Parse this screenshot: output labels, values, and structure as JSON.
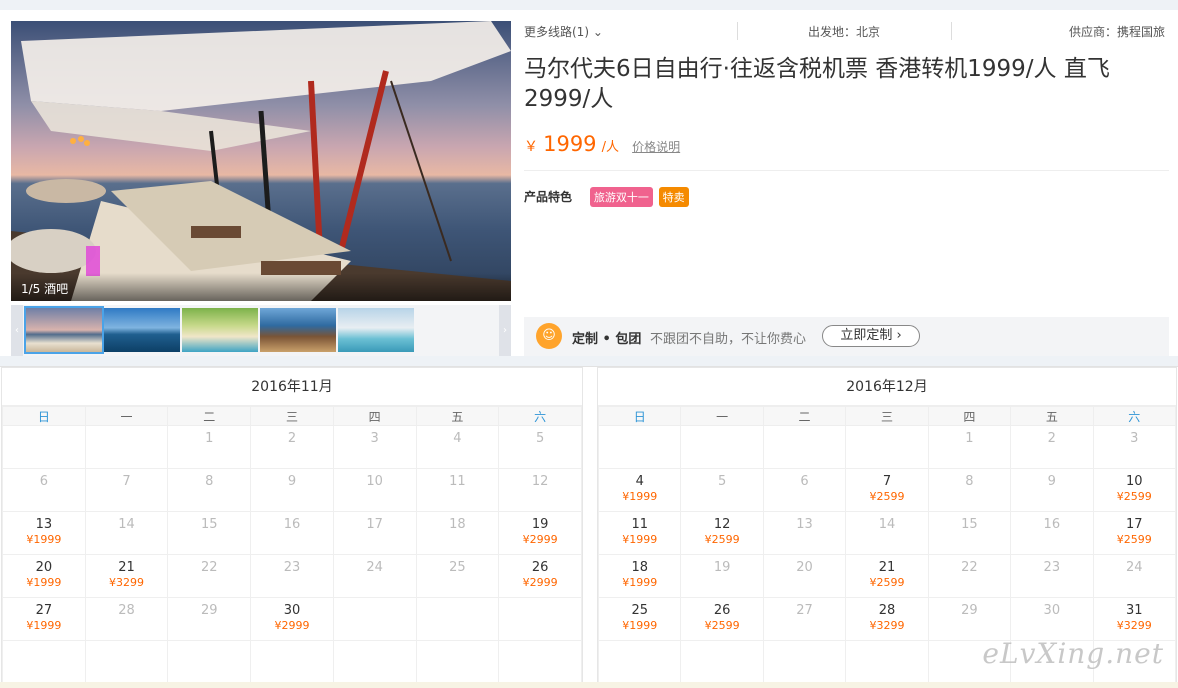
{
  "gallery": {
    "caption": "1/5 酒吧",
    "thumbs": [
      "thumb-1",
      "thumb-2",
      "thumb-3",
      "thumb-4",
      "thumb-5"
    ]
  },
  "info": {
    "more_routes": "更多线路(1)",
    "departure": "出发地：北京",
    "supplier": "供应商：携程国旅",
    "title": "马尔代夫6日自由行·往返含税机票 香港转机1999/人 直飞2999/人",
    "price_symbol": "￥",
    "price": "1999",
    "price_unit": "/人",
    "price_note": "价格说明",
    "feature_label": "产品特色",
    "tags": [
      "旅游双十一",
      "特卖"
    ]
  },
  "custom": {
    "name": "定制 • 包团",
    "desc": "不跟团不自助，不让你费心",
    "button": "立即定制 ›"
  },
  "calendar_nov": {
    "title": "2016年11月",
    "weekdays": [
      "日",
      "一",
      "二",
      "三",
      "四",
      "五",
      "六"
    ],
    "rows": [
      [
        {
          "d": ""
        },
        {
          "d": ""
        },
        {
          "d": "1"
        },
        {
          "d": "2"
        },
        {
          "d": "3"
        },
        {
          "d": "4"
        },
        {
          "d": "5"
        }
      ],
      [
        {
          "d": "6"
        },
        {
          "d": "7"
        },
        {
          "d": "8"
        },
        {
          "d": "9"
        },
        {
          "d": "10"
        },
        {
          "d": "11"
        },
        {
          "d": "12"
        }
      ],
      [
        {
          "d": "13",
          "p": "¥1999"
        },
        {
          "d": "14"
        },
        {
          "d": "15"
        },
        {
          "d": "16"
        },
        {
          "d": "17"
        },
        {
          "d": "18"
        },
        {
          "d": "19",
          "p": "¥2999"
        }
      ],
      [
        {
          "d": "20",
          "p": "¥1999"
        },
        {
          "d": "21",
          "p": "¥3299"
        },
        {
          "d": "22"
        },
        {
          "d": "23"
        },
        {
          "d": "24"
        },
        {
          "d": "25"
        },
        {
          "d": "26",
          "p": "¥2999"
        }
      ],
      [
        {
          "d": "27",
          "p": "¥1999"
        },
        {
          "d": "28"
        },
        {
          "d": "29"
        },
        {
          "d": "30",
          "p": "¥2999"
        },
        {
          "d": ""
        },
        {
          "d": ""
        },
        {
          "d": ""
        }
      ],
      [
        {
          "d": ""
        },
        {
          "d": ""
        },
        {
          "d": ""
        },
        {
          "d": ""
        },
        {
          "d": ""
        },
        {
          "d": ""
        },
        {
          "d": ""
        }
      ]
    ]
  },
  "calendar_dec": {
    "title": "2016年12月",
    "weekdays": [
      "日",
      "一",
      "二",
      "三",
      "四",
      "五",
      "六"
    ],
    "rows": [
      [
        {
          "d": ""
        },
        {
          "d": ""
        },
        {
          "d": ""
        },
        {
          "d": ""
        },
        {
          "d": "1"
        },
        {
          "d": "2"
        },
        {
          "d": "3"
        }
      ],
      [
        {
          "d": "4",
          "p": "¥1999"
        },
        {
          "d": "5"
        },
        {
          "d": "6"
        },
        {
          "d": "7",
          "p": "¥2599"
        },
        {
          "d": "8"
        },
        {
          "d": "9"
        },
        {
          "d": "10",
          "p": "¥2599"
        }
      ],
      [
        {
          "d": "11",
          "p": "¥1999"
        },
        {
          "d": "12",
          "p": "¥2599"
        },
        {
          "d": "13"
        },
        {
          "d": "14"
        },
        {
          "d": "15"
        },
        {
          "d": "16"
        },
        {
          "d": "17",
          "p": "¥2599"
        }
      ],
      [
        {
          "d": "18",
          "p": "¥1999"
        },
        {
          "d": "19"
        },
        {
          "d": "20"
        },
        {
          "d": "21",
          "p": "¥2599"
        },
        {
          "d": "22"
        },
        {
          "d": "23"
        },
        {
          "d": "24"
        }
      ],
      [
        {
          "d": "25",
          "p": "¥1999"
        },
        {
          "d": "26",
          "p": "¥2599"
        },
        {
          "d": "27"
        },
        {
          "d": "28",
          "p": "¥3299"
        },
        {
          "d": "29"
        },
        {
          "d": "30"
        },
        {
          "d": "31",
          "p": "¥3299"
        }
      ],
      [
        {
          "d": ""
        },
        {
          "d": ""
        },
        {
          "d": ""
        },
        {
          "d": ""
        },
        {
          "d": ""
        },
        {
          "d": ""
        },
        {
          "d": ""
        }
      ]
    ]
  },
  "watermark": "eLvXing.net"
}
